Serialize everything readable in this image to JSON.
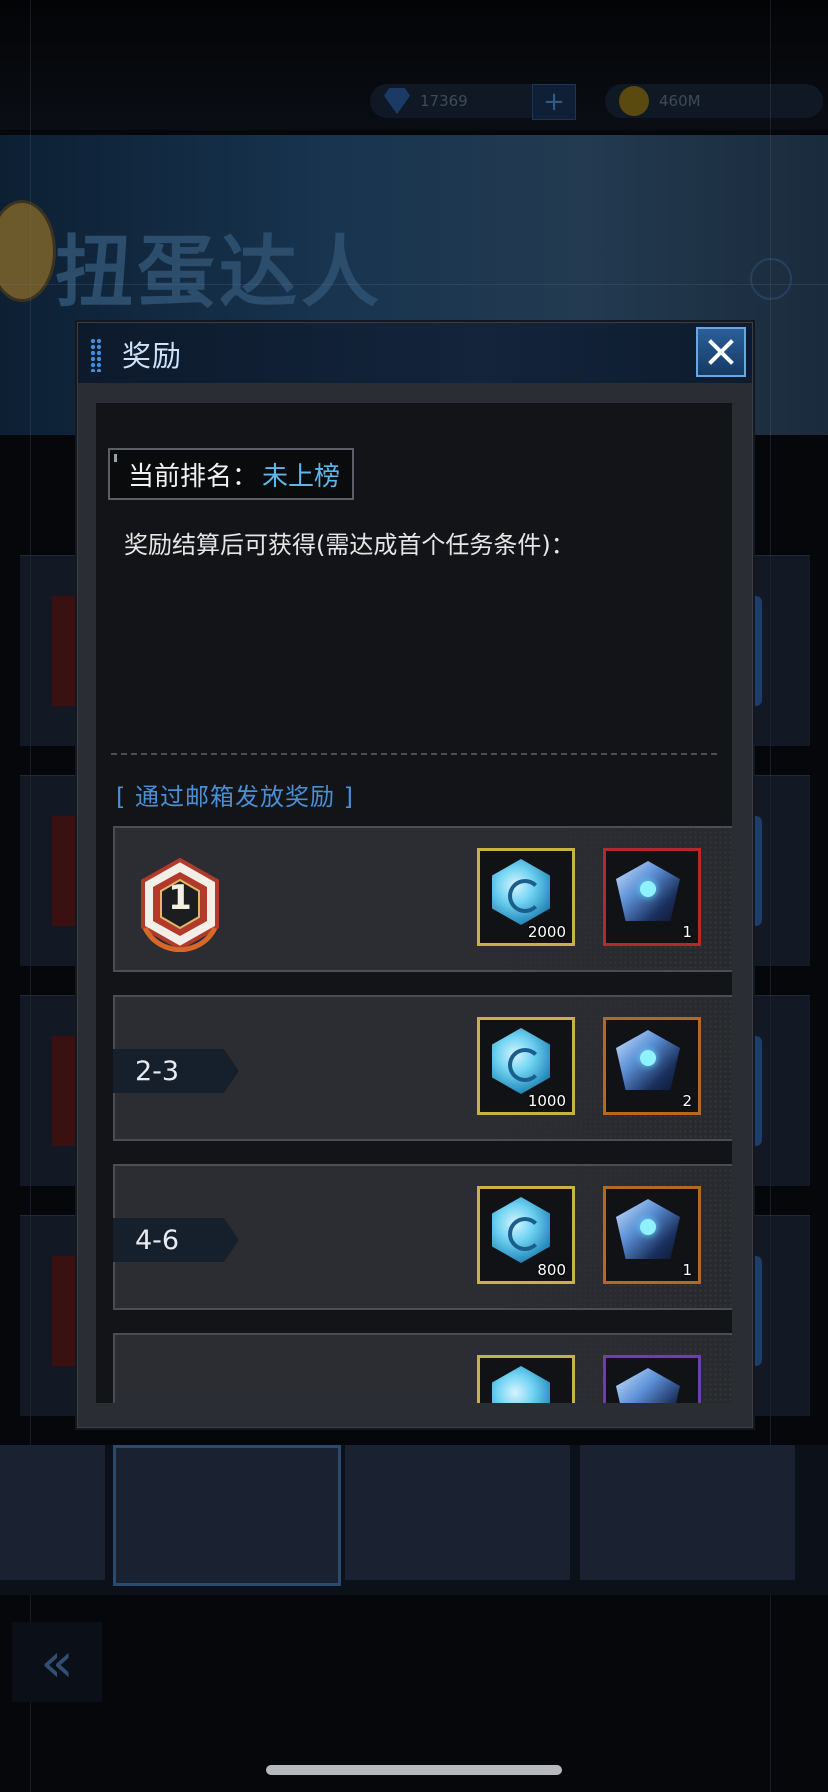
{
  "background": {
    "currency": [
      {
        "icon": "gem-icon",
        "value": "17369"
      },
      {
        "icon": "coin-icon",
        "value": "460M"
      }
    ],
    "banner_title": "扭蛋达人"
  },
  "dialog": {
    "title": "奖励",
    "rank_label": "当前排名：",
    "rank_value": "未上榜",
    "description": "奖励结算后可获得(需达成首个任务条件)：",
    "mail_note_open": "[",
    "mail_note": "通过邮箱发放奖励",
    "mail_note_close": "]",
    "tiers": [
      {
        "rank": "1",
        "rank_style": "medal",
        "items": [
          {
            "icon": "crystal-gem-icon",
            "frame": "gold",
            "qty": "2000"
          },
          {
            "icon": "energy-cube-icon",
            "frame": "red",
            "qty": "1"
          }
        ]
      },
      {
        "rank": "2-3",
        "rank_style": "tag",
        "items": [
          {
            "icon": "crystal-gem-icon",
            "frame": "gold",
            "qty": "1000"
          },
          {
            "icon": "energy-cube-icon",
            "frame": "orange",
            "qty": "2"
          }
        ]
      },
      {
        "rank": "4-6",
        "rank_style": "tag",
        "items": [
          {
            "icon": "crystal-gem-icon",
            "frame": "gold",
            "qty": "800"
          },
          {
            "icon": "energy-cube-icon",
            "frame": "orange",
            "qty": "1"
          }
        ]
      },
      {
        "rank": "",
        "rank_style": "tag",
        "items": [
          {
            "icon": "crystal-gem-icon",
            "frame": "gold",
            "qty": ""
          },
          {
            "icon": "energy-cube-icon",
            "frame": "purple",
            "qty": ""
          }
        ]
      }
    ]
  },
  "colors": {
    "accent_blue": "#5fb6ea",
    "frame_gold": "#c9b245",
    "frame_red": "#b5292a",
    "frame_orange": "#b36a1f",
    "frame_purple": "#6b3fb3"
  }
}
